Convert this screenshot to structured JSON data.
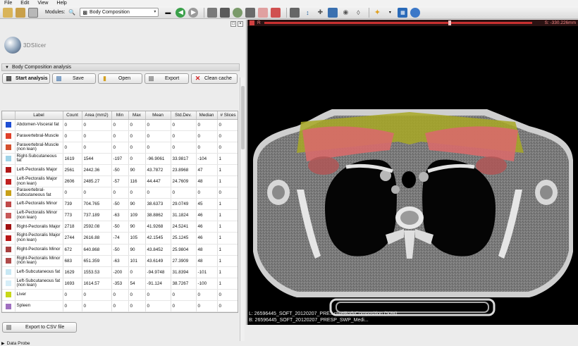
{
  "menu": [
    "File",
    "Edit",
    "View",
    "Help"
  ],
  "toolbar": {
    "modules_label": "Modules:",
    "module_selected": "Body Composition"
  },
  "logo_text": "3DSlicer",
  "section_title": "Body Composition analysis",
  "buttons": {
    "start": "Start analysis",
    "save": "Save",
    "open": "Open",
    "export": "Export",
    "clean": "Clean cache",
    "csv": "Export to CSV file"
  },
  "table": {
    "headers": [
      "",
      "Label",
      "Count",
      "Area (mm2)",
      "Min",
      "Max",
      "Mean",
      "Std.Dev.",
      "Median",
      "# Slices"
    ],
    "rows": [
      {
        "color": "#1f4fd4",
        "label": "Abdomen-Visceral fat",
        "count": "0",
        "area": "0",
        "min": "0",
        "max": "0",
        "mean": "0",
        "std": "0",
        "median": "0",
        "slices": "0"
      },
      {
        "color": "#e0402a",
        "label": "Paravertebral-Muscle",
        "count": "0",
        "area": "0",
        "min": "0",
        "max": "0",
        "mean": "0",
        "std": "0",
        "median": "0",
        "slices": "0"
      },
      {
        "color": "#d4502e",
        "label": "Paravertebral-Muscle (non lean)",
        "count": "0",
        "area": "0",
        "min": "0",
        "max": "0",
        "mean": "0",
        "std": "0",
        "median": "0",
        "slices": "0"
      },
      {
        "color": "#9fd3e8",
        "label": "Right-Subcutaneous fat",
        "count": "1619",
        "area": "1544",
        "min": "-197",
        "max": "0",
        "mean": "-96.9061",
        "std": "33.9817",
        "median": "-104",
        "slices": "1"
      },
      {
        "color": "#b01818",
        "label": "Left-Pectoralis Major",
        "count": "2561",
        "area": "2442.36",
        "min": "-50",
        "max": "90",
        "mean": "43.7872",
        "std": "23.8968",
        "median": "47",
        "slices": "1"
      },
      {
        "color": "#c02020",
        "label": "Left-Pectoralis Major (non lean)",
        "count": "2606",
        "area": "2485.27",
        "min": "-57",
        "max": "116",
        "mean": "44.447",
        "std": "24.7609",
        "median": "48",
        "slices": "1"
      },
      {
        "color": "#c8a018",
        "label": "Paravertebral-Subcutaneous fat",
        "count": "0",
        "area": "0",
        "min": "0",
        "max": "0",
        "mean": "0",
        "std": "0",
        "median": "0",
        "slices": "0"
      },
      {
        "color": "#c04a4a",
        "label": "Left-Pectoralis Minor",
        "count": "739",
        "area": "704.765",
        "min": "-50",
        "max": "90",
        "mean": "38.6373",
        "std": "29.0749",
        "median": "45",
        "slices": "1"
      },
      {
        "color": "#c85a5a",
        "label": "Left-Pectoralis Minor (non lean)",
        "count": "773",
        "area": "737.189",
        "min": "-63",
        "max": "109",
        "mean": "38.8862",
        "std": "31.1824",
        "median": "46",
        "slices": "1"
      },
      {
        "color": "#a01010",
        "label": "Right-Pectoralis Major",
        "count": "2718",
        "area": "2592.08",
        "min": "-50",
        "max": "90",
        "mean": "41.9268",
        "std": "24.5241",
        "median": "46",
        "slices": "1"
      },
      {
        "color": "#b81818",
        "label": "Right-Pectoralis Major (non lean)",
        "count": "2744",
        "area": "2616.88",
        "min": "-74",
        "max": "105",
        "mean": "42.1545",
        "std": "25.1245",
        "median": "46",
        "slices": "1"
      },
      {
        "color": "#a84040",
        "label": "Right-Pectoralis Minor",
        "count": "672",
        "area": "640.868",
        "min": "-50",
        "max": "90",
        "mean": "43.8452",
        "std": "25.9804",
        "median": "48",
        "slices": "1"
      },
      {
        "color": "#b04a4a",
        "label": "Right-Pectoralis Minor (non lean)",
        "count": "683",
        "area": "651.359",
        "min": "-63",
        "max": "101",
        "mean": "43.6149",
        "std": "27.3909",
        "median": "48",
        "slices": "1"
      },
      {
        "color": "#c8e8f4",
        "label": "Left-Subcutaneous fat",
        "count": "1629",
        "area": "1553.53",
        "min": "-200",
        "max": "0",
        "mean": "-94.9748",
        "std": "31.8394",
        "median": "-101",
        "slices": "1"
      },
      {
        "color": "#d6eef8",
        "label": "Left-Subcutaneous fat (non lean)",
        "count": "1693",
        "area": "1614.57",
        "min": "-353",
        "max": "54",
        "mean": "-91.124",
        "std": "38.7267",
        "median": "-100",
        "slices": "1"
      },
      {
        "color": "#c8d818",
        "label": "Liver",
        "count": "0",
        "area": "0",
        "min": "0",
        "max": "0",
        "mean": "0",
        "std": "0",
        "median": "0",
        "slices": "0"
      },
      {
        "color": "#a070c0",
        "label": "Spleen",
        "count": "0",
        "area": "0",
        "min": "0",
        "max": "0",
        "mean": "0",
        "std": "0",
        "median": "0",
        "slices": "0"
      }
    ]
  },
  "data_probe": "Data Probe",
  "viewer": {
    "pin_label": "R",
    "slice_offset": "S: -330.226mm",
    "footer_l": "L: 26596445_SOFT_20120207_PRE...ctiveBodyComposition (50%)",
    "footer_b": "B: 26596445_SOFT_20120207_PRESP_SWP_Medi..."
  }
}
